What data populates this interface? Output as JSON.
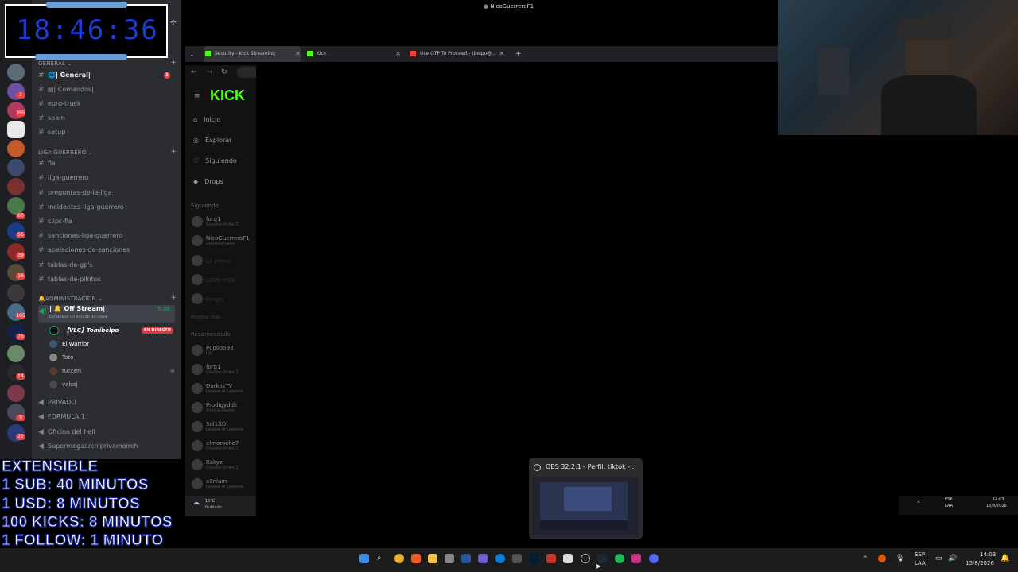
{
  "window_title": "NicoGuerreroF1",
  "clock_time": "18:46:36",
  "discord": {
    "server_title": "NicoGuerreroF1",
    "categories": {
      "general": "GENERAL",
      "liga": "LIGA GUERRERO",
      "admin": "ADMINISTRACION"
    },
    "general_channels": [
      {
        "label": "🌐| General|",
        "badge": "1"
      },
      {
        "label": "▤| Comandos|"
      },
      {
        "label": "euro-truck"
      },
      {
        "label": "spam"
      },
      {
        "label": "setup"
      }
    ],
    "liga_channels": [
      "fia",
      "liga-guerrero",
      "preguntas-de-la-liga",
      "incidentes-liga-guerrero",
      "clips-fia",
      "sanciones-liga-guerrero",
      "apelaciones-de-sanciones",
      "tablas-de-gp's",
      "tablas-de-pilotos"
    ],
    "voice_channel": {
      "label": "| 🔔 Off Stream|",
      "time": "5:48",
      "status": "Establece un estado de canal"
    },
    "voice_users": [
      {
        "name": "【VLC】Tomibelpo",
        "live": "EN DIRECTO"
      },
      {
        "name": "El Warrior"
      },
      {
        "name": "Toto"
      },
      {
        "name": "tucceri"
      },
      {
        "name": "valssj"
      }
    ],
    "other_channels": [
      "PRIVADO",
      "FORMULA 1",
      "Oficina del heli",
      "Supermegaarchiprivamoirch"
    ],
    "server_badges": [
      "2",
      "395",
      "60",
      "56",
      "39",
      "16",
      "165",
      "75",
      "14",
      "9",
      "22"
    ]
  },
  "overlay": {
    "line1": "EXTENSIBLE",
    "line2": "1 SUB: 40 MINUTOS",
    "line3": "1 USD: 8 MINUTOS",
    "line4": "100 KICKS: 8 MINUTOS",
    "line5": "1 FOLLOW: 1 MINUTO"
  },
  "browser": {
    "tabs": [
      {
        "label": "Security - Kick Streaming",
        "color": "#53fc18"
      },
      {
        "label": "Kick",
        "color": "#53fc18"
      },
      {
        "label": "Use OTP To Proceed - tbelpo@...",
        "color": "#ea4335"
      }
    ],
    "new_tab": "+"
  },
  "kick": {
    "logo": "KICK",
    "nav": [
      "Inicio",
      "Explorar",
      "Siguiendo",
      "Drops"
    ],
    "following_header": "Siguiendo",
    "following": [
      {
        "name": "forg1",
        "game": "Counter-Strike 2"
      },
      {
        "name": "NicoGuerreroF1",
        "game": "Desconectado"
      },
      {
        "name": "La Previa",
        "game": ""
      },
      {
        "name": "LEON KICK",
        "game": ""
      },
      {
        "name": "Kergio",
        "game": ""
      }
    ],
    "show_more": "Mostrar más",
    "recommended_header": "Recomendado",
    "recommended": [
      {
        "name": "Pupilo593",
        "game": "IRL"
      },
      {
        "name": "forg1",
        "game": "Counter-Strike 2"
      },
      {
        "name": "DarkozTV",
        "game": "League of Legends"
      },
      {
        "name": "Prodigyddk",
        "game": "Slots & Casino"
      },
      {
        "name": "Sol1XD",
        "game": "League of Legends"
      },
      {
        "name": "elmorocho7",
        "game": "Counter-Strike 2"
      },
      {
        "name": "Rakyz",
        "game": "Counter-Strike 2"
      },
      {
        "name": "x8nium",
        "game": "League of Legends"
      }
    ],
    "weather_temp": "15°C",
    "weather_desc": "Nublado"
  },
  "thumbnail": {
    "title": "OBS 32.2.1 - Perfil: tiktok -..."
  },
  "taskbar": {
    "lang": "ESP",
    "layout": "LAA",
    "time": "14:03",
    "date": "15/8/2026"
  }
}
